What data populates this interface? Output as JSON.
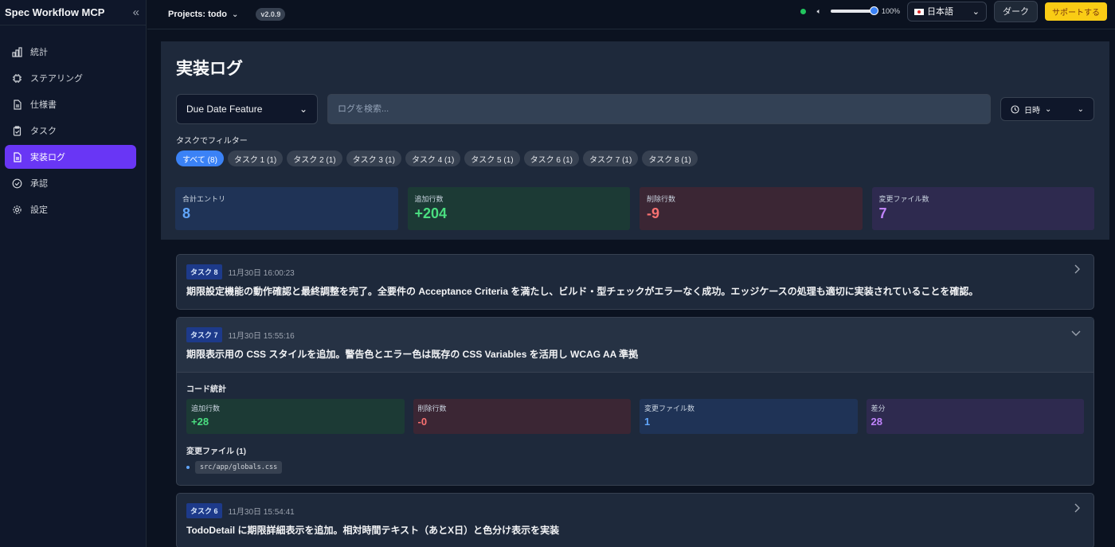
{
  "app": {
    "title": "Spec Workflow MCP"
  },
  "sidebar": {
    "items": [
      {
        "label": "統計",
        "icon": "bar-chart-icon"
      },
      {
        "label": "ステアリング",
        "icon": "chip-icon"
      },
      {
        "label": "仕様書",
        "icon": "document-icon"
      },
      {
        "label": "タスク",
        "icon": "clipboard-icon"
      },
      {
        "label": "実装ログ",
        "icon": "file-text-icon",
        "active": true
      },
      {
        "label": "承認",
        "icon": "check-circle-icon"
      },
      {
        "label": "設定",
        "icon": "gear-icon"
      }
    ]
  },
  "topbar": {
    "project_label": "Projects:",
    "project_value": "todo",
    "version": "v2.0.9",
    "volume_percent": "100%",
    "volume_level": 1.0,
    "language": "日本語",
    "theme_button": "ダーク",
    "support_button": "サポートする"
  },
  "page": {
    "title": "実装ログ",
    "feature_select": "Due Date Feature",
    "search_placeholder": "ログを検索...",
    "sort_label": "日時",
    "filter_label": "タスクでフィルター",
    "chips": [
      "すべて (8)",
      "タスク 1 (1)",
      "タスク 2 (1)",
      "タスク 3 (1)",
      "タスク 4 (1)",
      "タスク 5 (1)",
      "タスク 6 (1)",
      "タスク 7 (1)",
      "タスク 8 (1)"
    ],
    "stats": [
      {
        "label": "合計エントリ",
        "value": "8"
      },
      {
        "label": "追加行数",
        "value": "+204"
      },
      {
        "label": "削除行数",
        "value": "-9"
      },
      {
        "label": "変更ファイル数",
        "value": "7"
      }
    ]
  },
  "entries": [
    {
      "task": "タスク 8",
      "time": "11月30日 16:00:23",
      "summary": "期限設定機能の動作確認と最終調整を完了。全要件の Acceptance Criteria を満たし、ビルド・型チェックがエラーなく成功。エッジケースの処理も適切に実装されていることを確認。"
    },
    {
      "task": "タスク 7",
      "time": "11月30日 15:55:16",
      "summary": "期限表示用の CSS スタイルを追加。警告色とエラー色は既存の CSS Variables を活用し WCAG AA 準拠",
      "details": {
        "code_stats_title": "コード統計",
        "stats": [
          {
            "label": "追加行数",
            "value": "+28"
          },
          {
            "label": "削除行数",
            "value": "-0"
          },
          {
            "label": "変更ファイル数",
            "value": "1"
          },
          {
            "label": "差分",
            "value": "28"
          }
        ],
        "files_title": "変更ファイル (1)",
        "files": [
          "src/app/globals.css"
        ]
      }
    },
    {
      "task": "タスク 6",
      "time": "11月30日 15:54:41",
      "summary": "TodoDetail に期限詳細表示を追加。相対時間テキスト（あとX日）と色分け表示を実装"
    }
  ]
}
